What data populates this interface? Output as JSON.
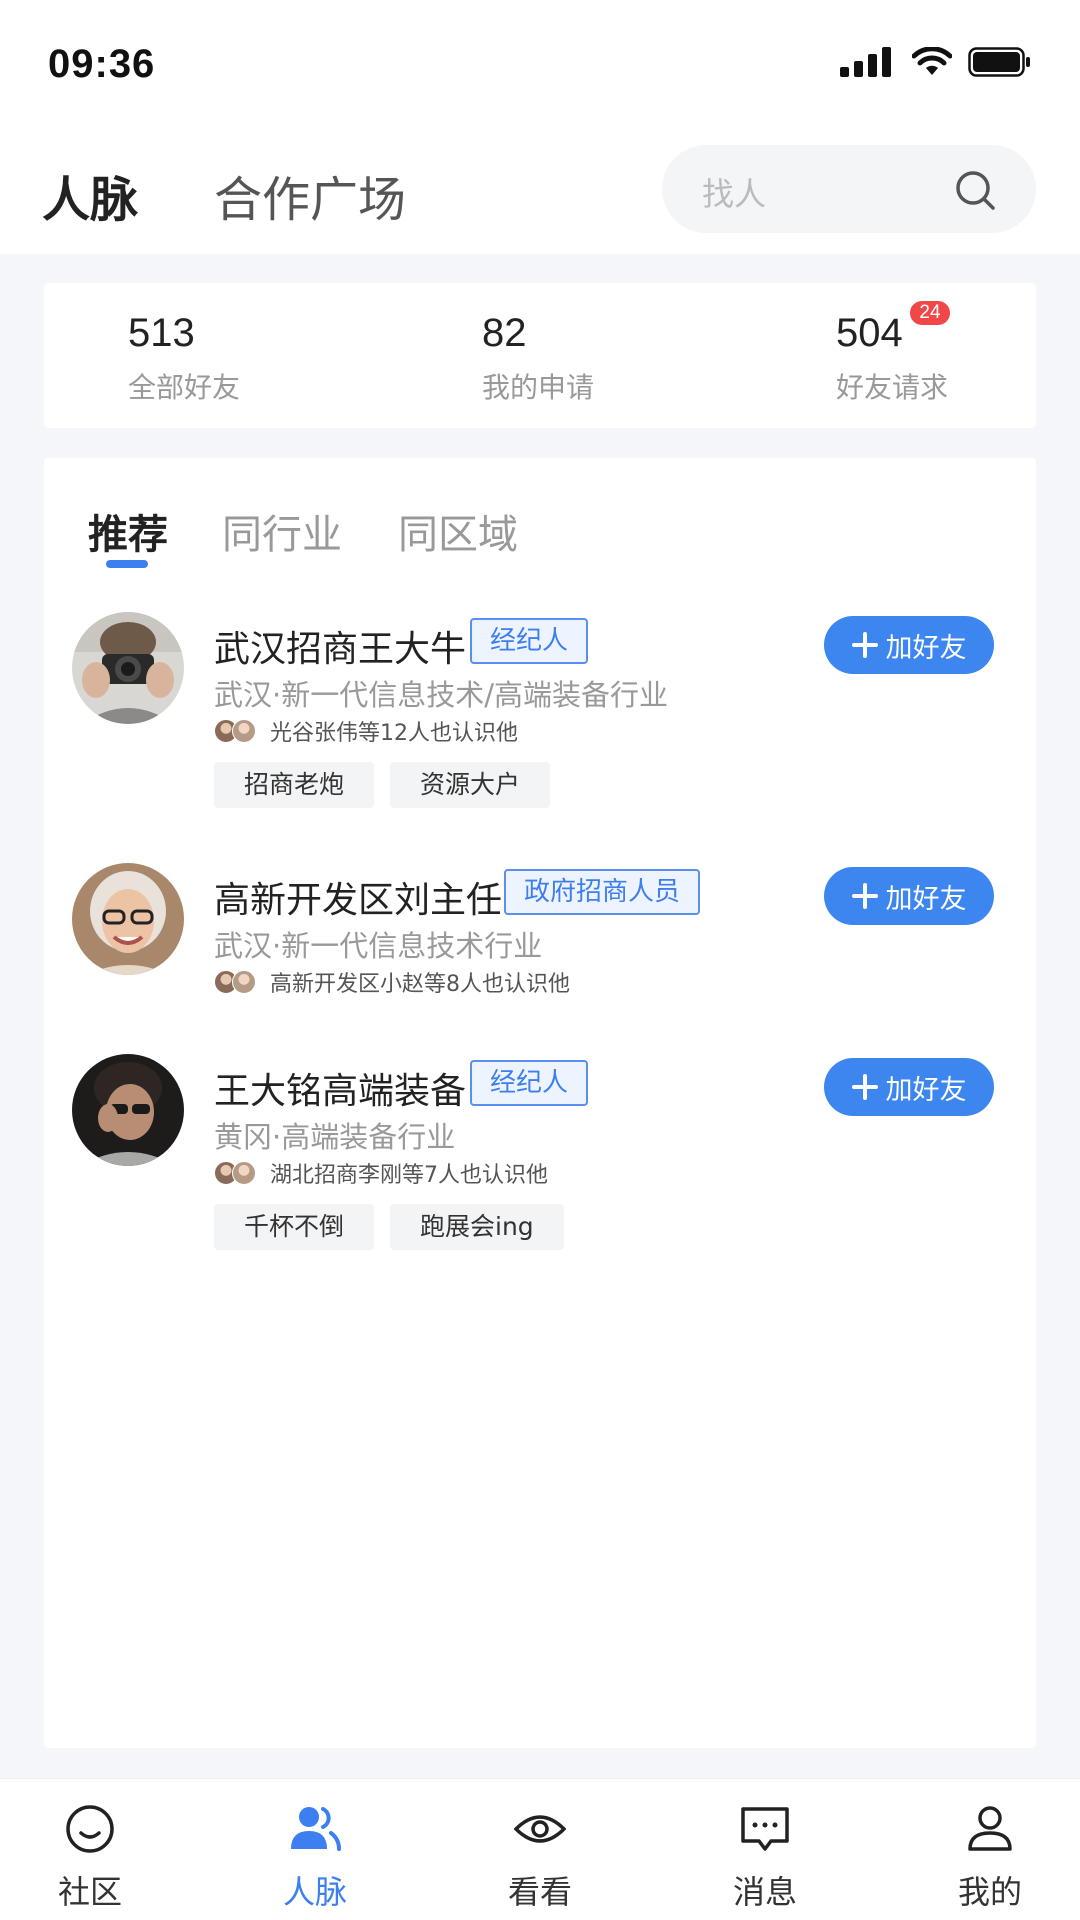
{
  "status_bar": {
    "time": "09:36"
  },
  "header": {
    "tab_active": "人脉",
    "tab_other": "合作广场",
    "search_placeholder": "找人"
  },
  "stats": [
    {
      "number": "513",
      "label": "全部好友"
    },
    {
      "number": "82",
      "label": "我的申请"
    },
    {
      "number": "504",
      "label": "好友请求",
      "badge": "24"
    }
  ],
  "subtabs": [
    "推荐",
    "同行业",
    "同区域"
  ],
  "people": [
    {
      "name": "武汉招商王大牛",
      "role": "经纪人",
      "desc": "武汉·新一代信息技术/高端装备行业",
      "mutual": "光谷张伟等12人也认识他",
      "tags": [
        "招商老炮",
        "资源大户"
      ],
      "button": "加好友"
    },
    {
      "name": "高新开发区刘主任",
      "role": "政府招商人员",
      "desc": "武汉·新一代信息技术行业",
      "mutual": "高新开发区小赵等8人也认识他",
      "tags": [],
      "button": "加好友"
    },
    {
      "name": "王大铭高端装备",
      "role": "经纪人",
      "desc": "黄冈·高端装备行业",
      "mutual": "湖北招商李刚等7人也认识他",
      "tags": [
        "千杯不倒",
        "跑展会ing"
      ],
      "button": "加好友"
    }
  ],
  "tabbar": [
    {
      "label": "社区",
      "icon": "smile-icon"
    },
    {
      "label": "人脉",
      "icon": "contacts-icon",
      "active": true
    },
    {
      "label": "看看",
      "icon": "eye-icon"
    },
    {
      "label": "消息",
      "icon": "message-icon"
    },
    {
      "label": "我的",
      "icon": "profile-icon"
    }
  ],
  "colors": {
    "accent": "#3d7ef0",
    "badge": "#f04848",
    "background": "#f4f6fa"
  }
}
